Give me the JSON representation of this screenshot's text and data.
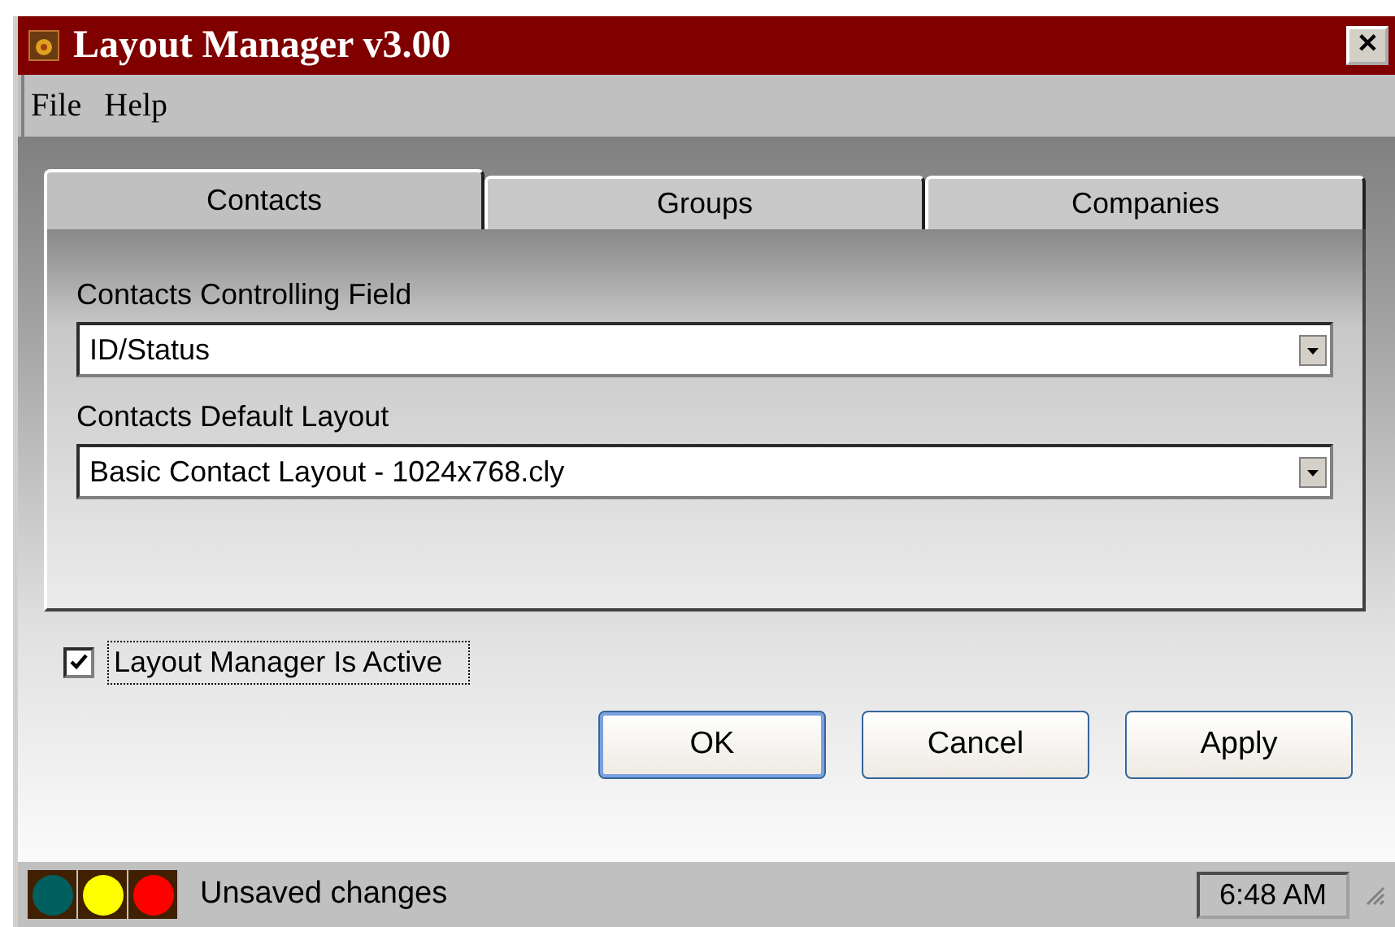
{
  "window": {
    "title": "Layout Manager v3.00",
    "close": "✕"
  },
  "menu": [
    "File",
    "Help"
  ],
  "tabs": [
    {
      "label": "Contacts",
      "selected": true
    },
    {
      "label": "Groups",
      "selected": false
    },
    {
      "label": "Companies",
      "selected": false
    }
  ],
  "fields": [
    {
      "label": "Contacts Controlling Field",
      "value": "ID/Status"
    },
    {
      "label": "Contacts Default Layout",
      "value": "Basic Contact Layout - 1024x768.cly"
    }
  ],
  "active_checkbox": {
    "label": "Layout Manager Is Active",
    "checked": true
  },
  "buttons": [
    {
      "label": "OK",
      "default": true
    },
    {
      "label": "Cancel",
      "default": false
    },
    {
      "label": "Apply",
      "default": false
    }
  ],
  "status_bar": {
    "lights": [
      {
        "color": "#006060"
      },
      {
        "color": "#ffff00"
      },
      {
        "color": "#ff0000"
      }
    ],
    "message": "Unsaved changes",
    "time": "6:48 AM"
  }
}
